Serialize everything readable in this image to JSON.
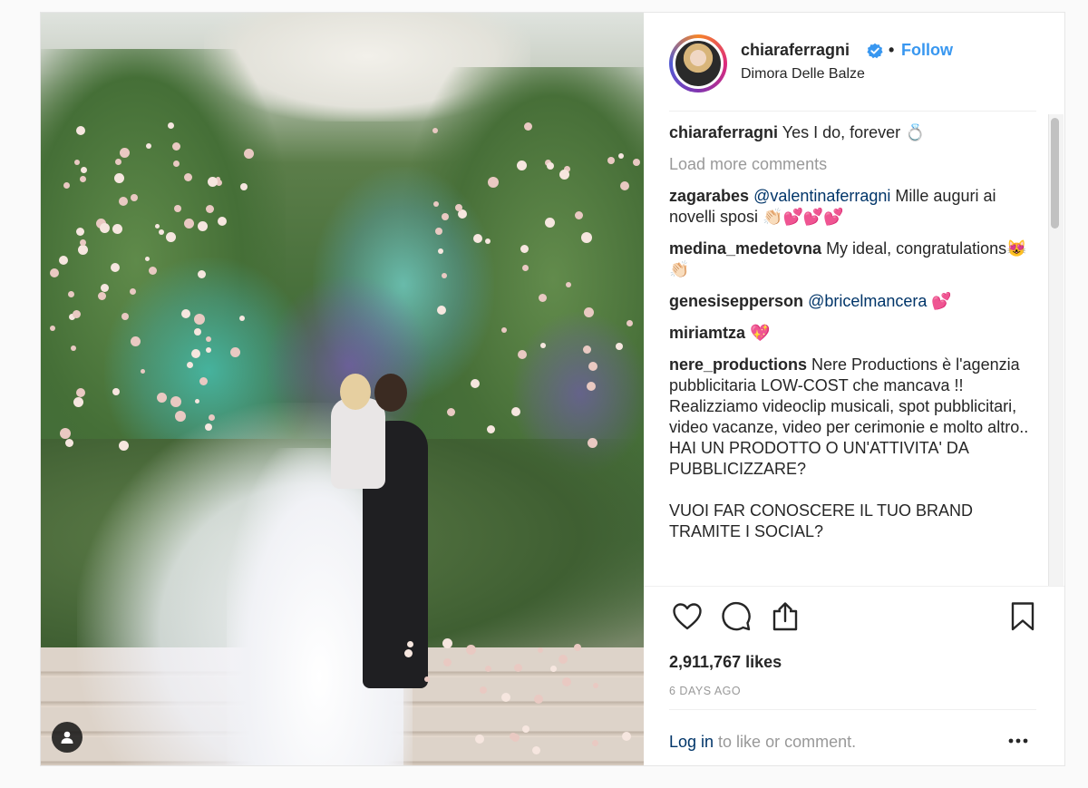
{
  "post": {
    "username": "chiaraferragni",
    "follow_label": "Follow",
    "separator": "•",
    "location": "Dimora Delle Balze",
    "colors": {
      "follow": "#3897f0",
      "mention": "#003569",
      "muted": "#999999",
      "verified": "#3897f0"
    }
  },
  "comments": [
    {
      "user": "chiaraferragni",
      "text": " Yes I do, forever 💍"
    },
    {
      "user": "zagarabes",
      "mention": " @valentinaferragni",
      "text": " Mille auguri ai novelli sposi 👏🏻💕💕💕"
    },
    {
      "user": "medina_medetovna",
      "text": " My ideal, congratulations😻👏🏻"
    },
    {
      "user": "genesisepperson",
      "mention": " @bricelmancera",
      "text": " 💕"
    },
    {
      "user": "miriamtza",
      "text": " 💖"
    },
    {
      "user": "nere_productions",
      "text": " Nere Productions è l'agenzia pubblicitaria LOW-COST che mancava !! Realizziamo videoclip musicali, spot pubblicitari, video vacanze, video per cerimonie e molto altro.. HAI UN PRODOTTO O UN'ATTIVITA' DA PUBBLICIZZARE?"
    },
    {
      "user": "",
      "text": "VUOI FAR CONOSCERE IL TUO BRAND TRAMITE I SOCIAL?"
    }
  ],
  "load_more": "Load more comments",
  "likes": "2,911,767 likes",
  "date": "6 DAYS AGO",
  "login": {
    "link": "Log in",
    "rest": " to like or comment."
  },
  "more_label": "•••",
  "icons": [
    "heart-icon",
    "comment-icon",
    "share-icon",
    "bookmark-icon",
    "user-tag-icon",
    "verified-badge-icon",
    "more-options-icon"
  ]
}
